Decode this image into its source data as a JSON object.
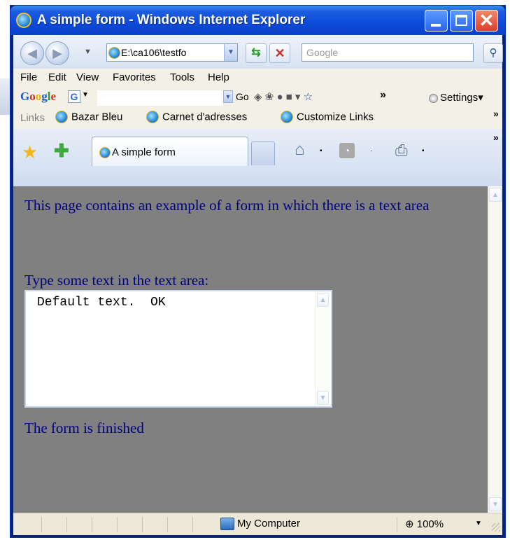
{
  "window": {
    "title": "A simple form - Windows Internet Explorer",
    "minimize_label": "",
    "maximize_label": "",
    "close_label": "✕"
  },
  "address_bar": {
    "url": "E:\\ca106\\testfo",
    "search_placeholder": "Google"
  },
  "menu": [
    "File",
    "Edit",
    "View",
    "Favorites",
    "Tools",
    "Help"
  ],
  "google_toolbar": {
    "logo": "Google",
    "go_label": "Go",
    "settings_label": "Settings"
  },
  "links_bar": {
    "label": "Links",
    "items": [
      "Bazar Bleu",
      "Carnet d'adresses",
      "Customize Links"
    ]
  },
  "tabs": [
    {
      "label": "A simple form",
      "active": true
    }
  ],
  "page": {
    "intro": "This page contains an example of a form in which there is a text area",
    "prompt": "Type some text in the text area:",
    "textarea_value": "Default text.  OK",
    "footer": "The form is finished",
    "background_color": "#808080",
    "text_color": "#000080"
  },
  "status_bar": {
    "zone": "My Computer",
    "zoom": "100%"
  },
  "icons": {
    "back": "back-arrow-icon",
    "forward": "forward-arrow-icon",
    "refresh": "refresh-icon",
    "stop": "stop-icon",
    "search": "search-icon",
    "favorites": "star-icon",
    "add_favorite": "add-favorite-icon",
    "home": "home-icon",
    "feeds": "rss-icon",
    "print": "print-icon"
  }
}
